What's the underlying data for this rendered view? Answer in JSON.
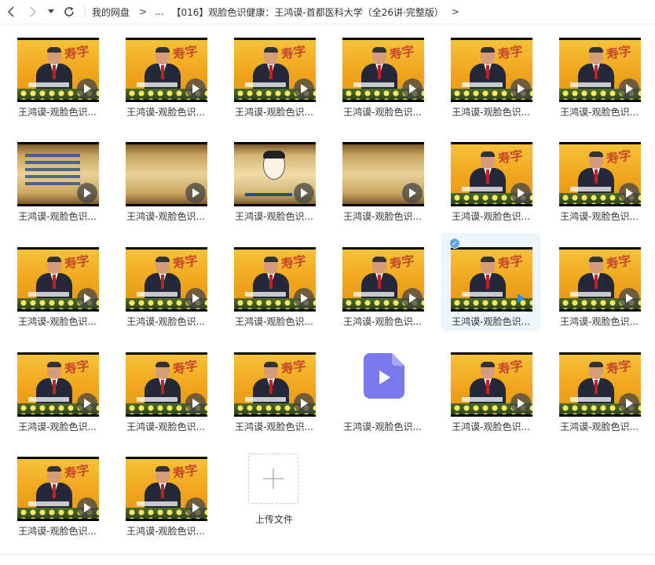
{
  "toolbar": {
    "back_icon": "chevron-left-icon",
    "forward_icon": "chevron-right-icon",
    "history_icon": "caret-down-icon",
    "refresh_icon": "refresh-icon"
  },
  "breadcrumb": {
    "root": "我的网盘",
    "separator": ">",
    "ellipsis": "...",
    "current": "【016】观脸色识健康：王鸿谟-首都医科大学（全26讲·完整版）"
  },
  "files": [
    {
      "label": "王鸿谟-观脸色识...",
      "thumb": "studio"
    },
    {
      "label": "王鸿谟-观脸色识...",
      "thumb": "studio"
    },
    {
      "label": "王鸿谟-观脸色识...",
      "thumb": "studio"
    },
    {
      "label": "王鸿谟-观脸色识...",
      "thumb": "studio"
    },
    {
      "label": "王鸿谟-观脸色识...",
      "thumb": "studio"
    },
    {
      "label": "王鸿谟-观脸色识...",
      "thumb": "studio"
    },
    {
      "label": "王鸿谟-观脸色识...",
      "thumb": "scroll-text"
    },
    {
      "label": "王鸿谟-观脸色识...",
      "thumb": "scroll"
    },
    {
      "label": "王鸿谟-观脸色识...",
      "thumb": "face"
    },
    {
      "label": "王鸿谟-观脸色识...",
      "thumb": "scroll"
    },
    {
      "label": "王鸿谟-观脸色识...",
      "thumb": "studio"
    },
    {
      "label": "王鸿谟-观脸色识...",
      "thumb": "studio"
    },
    {
      "label": "王鸿谟-观脸色识...",
      "thumb": "studio"
    },
    {
      "label": "王鸿谟-观脸色识...",
      "thumb": "studio"
    },
    {
      "label": "王鸿谟-观脸色识...",
      "thumb": "studio"
    },
    {
      "label": "王鸿谟-观脸色识...",
      "thumb": "studio"
    },
    {
      "label": "王鸿谟-观脸色识...",
      "thumb": "studio",
      "selected": true
    },
    {
      "label": "王鸿谟-观脸色识...",
      "thumb": "studio"
    },
    {
      "label": "王鸿谟-观脸色识...",
      "thumb": "studio"
    },
    {
      "label": "王鸿谟-观脸色识...",
      "thumb": "studio"
    },
    {
      "label": "王鸿谟-观脸色识...",
      "thumb": "studio"
    },
    {
      "label": "王鸿谟-观脸色识...",
      "thumb": "video-file-icon"
    },
    {
      "label": "王鸿谟-观脸色识...",
      "thumb": "studio"
    },
    {
      "label": "王鸿谟-观脸色识...",
      "thumb": "studio"
    },
    {
      "label": "王鸿谟-观脸色识...",
      "thumb": "studio"
    },
    {
      "label": "王鸿谟-观脸色识...",
      "thumb": "studio"
    }
  ],
  "upload": {
    "label": "上传文件",
    "icon": "plus-icon"
  },
  "colors": {
    "selected_bg": "#eef6fd",
    "check_blue": "#5aa6ee",
    "file_icon_purple": "#7b78ee",
    "play_blue": "#2b8ff0"
  }
}
